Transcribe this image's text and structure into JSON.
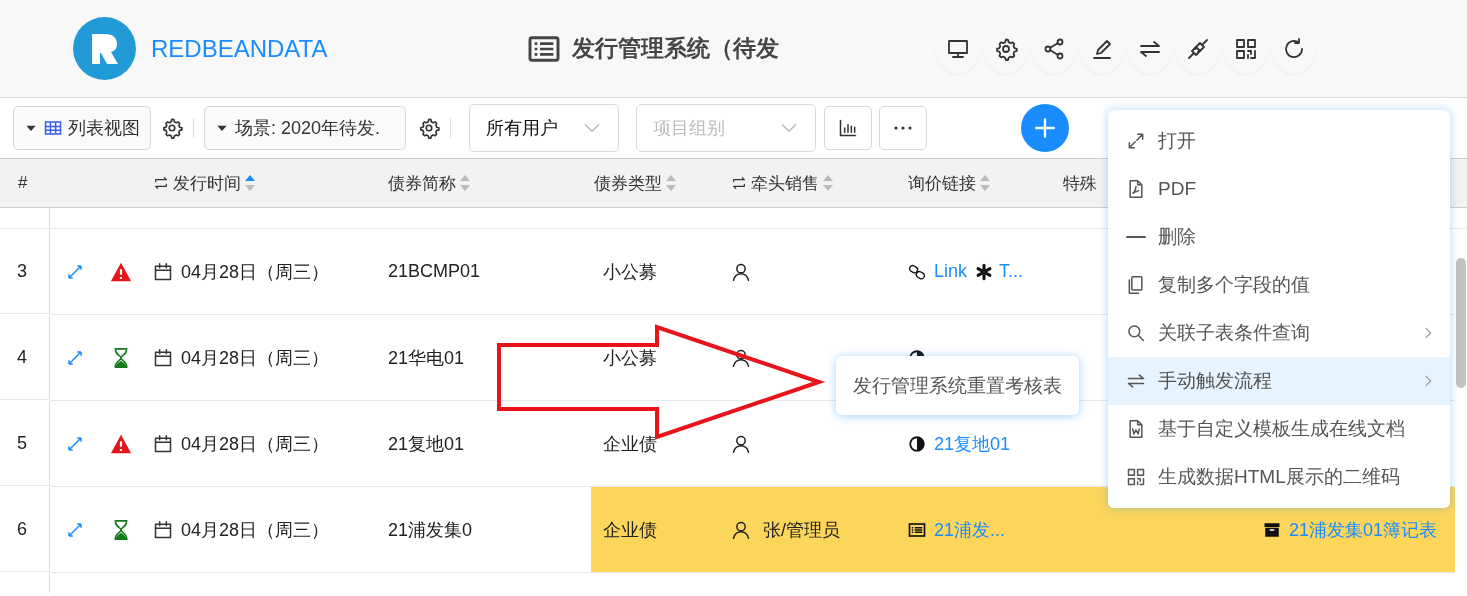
{
  "header": {
    "brand": "REDBEANDATA",
    "title": "发行管理系统（待发",
    "actions": [
      {
        "kind": "monitor"
      },
      {
        "kind": "gear"
      },
      {
        "kind": "share"
      },
      {
        "kind": "pen"
      },
      {
        "kind": "swap"
      },
      {
        "kind": "plug"
      },
      {
        "kind": "qr"
      },
      {
        "kind": "refresh"
      }
    ]
  },
  "toolbar": {
    "view": "列表视图",
    "scene": "场景: 2020年待发.",
    "user_filter": "所有用户",
    "group_filter": {
      "placeholder": "项目组别"
    }
  },
  "table": {
    "columns": [
      {
        "label": "#"
      },
      {
        "label": "发行时间",
        "sortable": true,
        "sorted_ascending": true,
        "swap": true
      },
      {
        "label": "债券简称",
        "sortable": true,
        "sorted_ascending": false,
        "swap": false
      },
      {
        "label": "债券类型",
        "sortable": true,
        "sorted_ascending": false,
        "swap": false
      },
      {
        "label": "牵头销售",
        "sortable": true,
        "sorted_ascending": false,
        "swap": true
      },
      {
        "label": "询价链接",
        "sortable": true,
        "sorted_ascending": false,
        "swap": false
      },
      {
        "label": "特殊"
      }
    ],
    "rows": [
      {
        "number": "3",
        "kind": "warning",
        "date": "04月28日（周三）",
        "name": "21BCMP01",
        "type": "小公募",
        "highlighted": false,
        "link": {
          "kind": "chain",
          "parts": [
            "Link",
            "T..."
          ]
        }
      },
      {
        "number": "4",
        "kind": "pending",
        "date": "04月28日（周三）",
        "name": "21华电01",
        "type": "小公募",
        "highlighted": false,
        "link": {
          "kind": "contrast"
        }
      },
      {
        "number": "5",
        "kind": "warning",
        "date": "04月28日（周三）",
        "name": "21复地01",
        "type": "企业债",
        "highlighted": false,
        "link": {
          "kind": "contrast",
          "parts": [
            "21复地01"
          ]
        }
      },
      {
        "number": "6",
        "kind": "pending",
        "date": "04月28日（周三）",
        "name": "21浦发集0",
        "type": "企业债",
        "sales": "张/管理员",
        "highlighted": true,
        "link": {
          "kind": "list",
          "parts": [
            "21浦发..."
          ]
        },
        "record": "21浦发集01簿记表"
      }
    ]
  },
  "context_menu": {
    "items": [
      {
        "kind": "expand",
        "label": "打开",
        "submenu": false,
        "selected": false
      },
      {
        "kind": "pdf",
        "label": "PDF",
        "submenu": false,
        "selected": false
      },
      {
        "kind": "minus",
        "label": "删除",
        "submenu": false,
        "selected": false
      },
      {
        "kind": "copy",
        "label": "复制多个字段的值",
        "submenu": false,
        "selected": false
      },
      {
        "kind": "search",
        "label": "关联子表条件查询",
        "submenu": true,
        "selected": false
      },
      {
        "kind": "swap",
        "label": "手动触发流程",
        "submenu": true,
        "selected": true
      },
      {
        "kind": "doc",
        "label": "基于自定义模板生成在线文档",
        "submenu": false,
        "selected": false
      },
      {
        "kind": "qr",
        "label": "生成数据HTML展示的二维码",
        "submenu": false,
        "selected": false
      }
    ]
  },
  "submenu_tooltip": "发行管理系统重置考核表"
}
